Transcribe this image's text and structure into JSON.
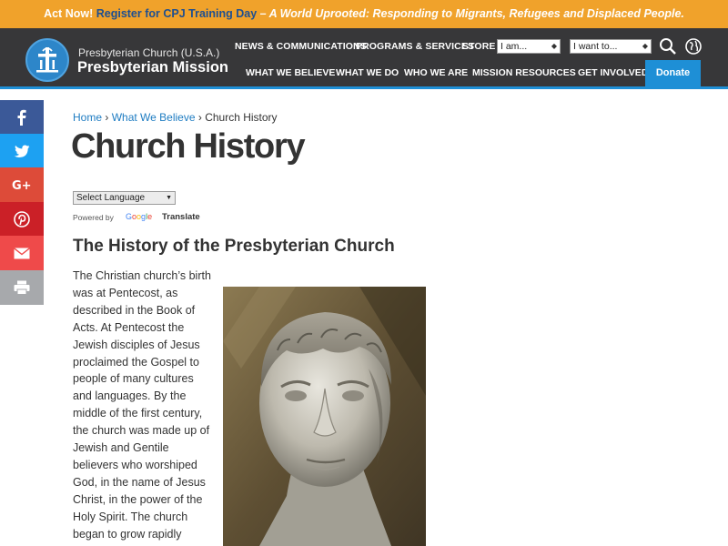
{
  "announcement": {
    "lead": "Act Now!",
    "link": "Register for CPJ Training Day",
    "rest": "– A World Uprooted: Responding to Migrants, Refugees and Displaced People."
  },
  "org": {
    "line1": "Presbyterian Church (U.S.A.)",
    "line2": "Presbyterian Mission"
  },
  "top_nav": {
    "news": "NEWS & COMMUNICATIONS",
    "programs": "PROGRAMS & SERVICES",
    "store": "STORE",
    "i_am": "I am...",
    "i_want": "I want to..."
  },
  "main_nav": {
    "believe": "WHAT WE BELIEVE",
    "do": "WHAT WE DO",
    "who": "WHO WE ARE",
    "resources": "MISSION RESOURCES",
    "involved": "GET INVOLVED",
    "donate": "Donate"
  },
  "share_icons": [
    {
      "icon": "facebook-icon",
      "color": "#3b5998"
    },
    {
      "icon": "twitter-icon",
      "color": "#1da1f2"
    },
    {
      "icon": "google-plus-icon",
      "color": "#dd4b39"
    },
    {
      "icon": "pinterest-icon",
      "color": "#cb2027"
    },
    {
      "icon": "email-icon",
      "color": "#ef4a4a"
    },
    {
      "icon": "print-icon",
      "color": "#a7a9ac"
    }
  ],
  "breadcrumb": {
    "home": "Home",
    "sep1": " › ",
    "believe": "What We Believe",
    "sep2": " › ",
    "current": "Church History"
  },
  "page_title": "Church History",
  "translate": {
    "select_label": "Select Language",
    "powered_by": "Powered by",
    "translate_label": "Translate"
  },
  "section_heading": "The History of the Presbyterian Church",
  "body_lines": [
    "The Christian church’s birth",
    "was at Pentecost, as",
    "described in the Book of",
    "Acts. At Pentecost the",
    "Jewish disciples of Jesus",
    "proclaimed the Gospel to",
    "people of many cultures",
    "and languages. By the",
    "middle of the first century,",
    "the church was made up of",
    "Jewish and Gentile",
    "believers who worshiped",
    "God, in the name of Jesus",
    "Christ, in the power of the",
    "Holy Spirit. The church",
    "began to grow rapidly"
  ],
  "colors": {
    "announcement_bg": "#f0a22b",
    "header_bg": "#373739",
    "accent_blue": "#1e8fd6",
    "link_blue": "#1e7cc2"
  }
}
